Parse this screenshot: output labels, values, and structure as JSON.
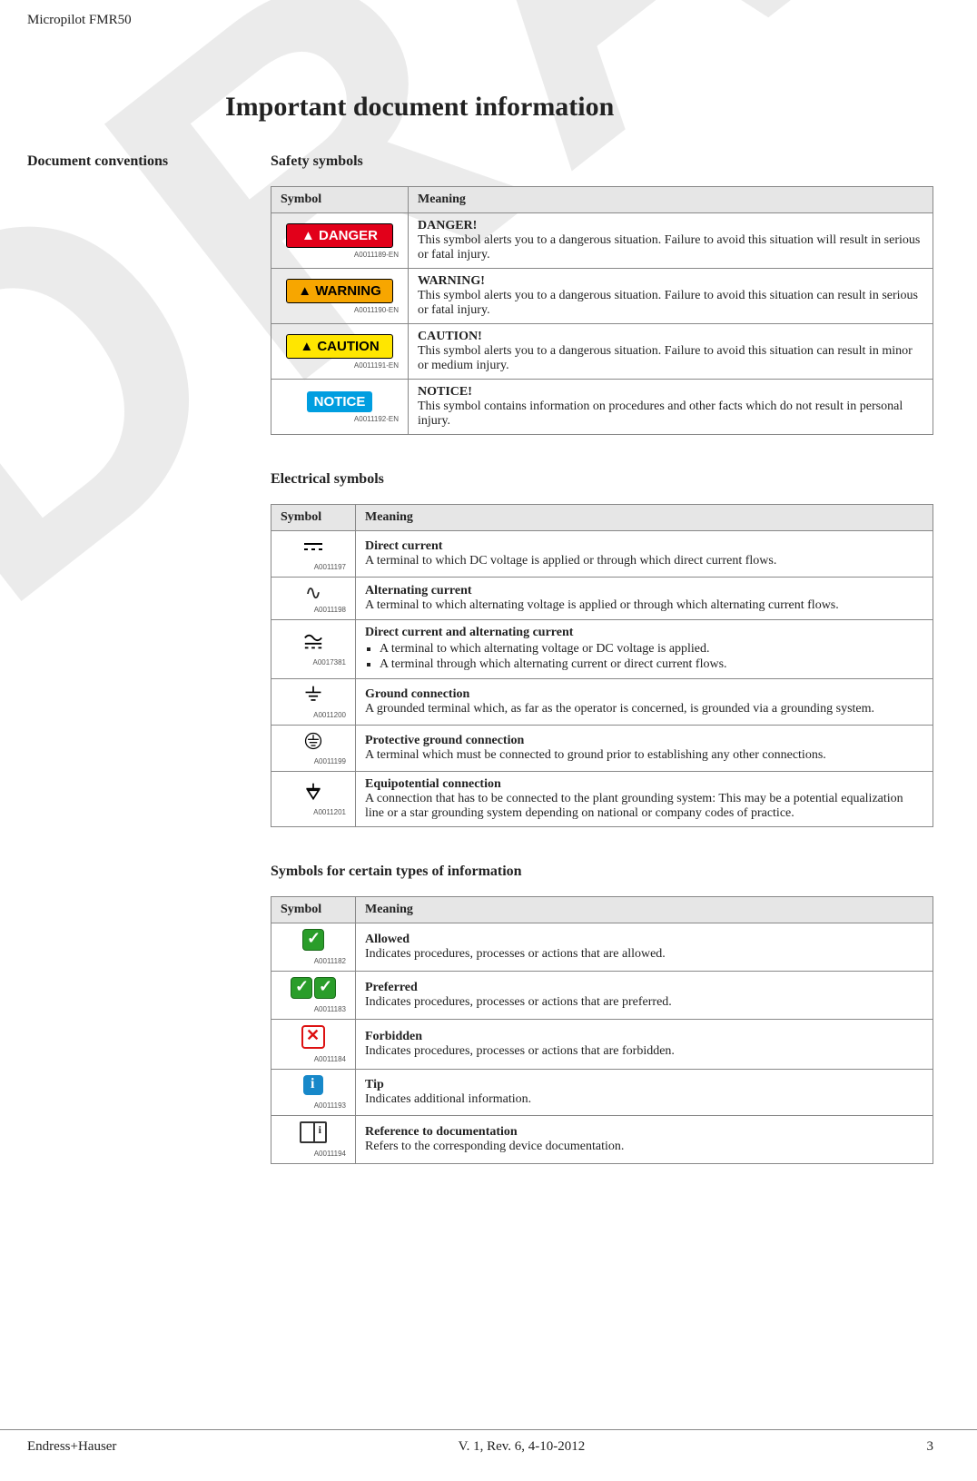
{
  "header": {
    "product": "Micropilot FMR50"
  },
  "title": "Important document information",
  "sideLabel": "Document conventions",
  "safety": {
    "heading": "Safety symbols",
    "cols": {
      "symbol": "Symbol",
      "meaning": "Meaning"
    },
    "rows": [
      {
        "badge": "DANGER",
        "badgeClass": "danger",
        "ref": "A0011189-EN",
        "title": "DANGER!",
        "desc": "This symbol alerts you to a dangerous situation. Failure to avoid this situation will result in serious or fatal injury."
      },
      {
        "badge": "WARNING",
        "badgeClass": "warning",
        "ref": "A0011190-EN",
        "title": "WARNING!",
        "desc": "This symbol alerts you to a dangerous situation. Failure to avoid this situation can result in serious or fatal injury."
      },
      {
        "badge": "CAUTION",
        "badgeClass": "caution",
        "ref": "A0011191-EN",
        "title": "CAUTION!",
        "desc": "This symbol alerts you to a dangerous situation. Failure to avoid this situation can result in minor or medium injury."
      },
      {
        "badge": "NOTICE",
        "badgeClass": "notice",
        "ref": "A0011192-EN",
        "title": "NOTICE!",
        "desc": "This symbol contains information on procedures and other facts which do not result in personal injury."
      }
    ]
  },
  "electrical": {
    "heading": "Electrical symbols",
    "cols": {
      "symbol": "Symbol",
      "meaning": "Meaning"
    },
    "rows": [
      {
        "icon": "dc",
        "ref": "A0011197",
        "title": "Direct current",
        "desc": "A terminal to which DC voltage is applied or through which direct current flows."
      },
      {
        "icon": "ac",
        "ref": "A0011198",
        "title": "Alternating current",
        "desc": "A terminal to which alternating voltage is applied or through which alternating current flows."
      },
      {
        "icon": "acdc",
        "ref": "A0017381",
        "title": "Direct current and alternating current",
        "bullets": [
          "A terminal to which alternating voltage or DC voltage is applied.",
          "A terminal through which alternating current or direct current flows."
        ]
      },
      {
        "icon": "gnd",
        "ref": "A0011200",
        "title": "Ground connection",
        "desc": "A grounded terminal which, as far as the operator is concerned, is grounded via a grounding system."
      },
      {
        "icon": "pe",
        "ref": "A0011199",
        "title": "Protective ground connection",
        "desc": "A terminal which must be connected to ground prior to establishing any other connections."
      },
      {
        "icon": "eq",
        "ref": "A0011201",
        "title": "Equipotential connection",
        "desc": "A connection that has to be connected to the plant grounding system: This may be a potential equalization line or a star grounding system depending on national or company codes of practice."
      }
    ]
  },
  "info": {
    "heading": "Symbols for certain types of information",
    "cols": {
      "symbol": "Symbol",
      "meaning": "Meaning"
    },
    "rows": [
      {
        "icon": "allowed",
        "ref": "A0011182",
        "title": "Allowed",
        "desc": "Indicates procedures, processes or actions that are allowed."
      },
      {
        "icon": "preferred",
        "ref": "A0011183",
        "title": "Preferred",
        "desc": "Indicates procedures, processes or actions that are preferred."
      },
      {
        "icon": "forbidden",
        "ref": "A0011184",
        "title": "Forbidden",
        "desc": "Indicates procedures, processes or actions that are forbidden."
      },
      {
        "icon": "tip",
        "ref": "A0011193",
        "title": "Tip",
        "desc": "Indicates additional information."
      },
      {
        "icon": "docref",
        "ref": "A0011194",
        "title": "Reference to documentation",
        "desc": "Refers to the corresponding device documentation."
      }
    ]
  },
  "footer": {
    "left": "Endress+Hauser",
    "center": "V. 1, Rev. 6, 4-10-2012",
    "right": "3"
  },
  "watermark": "DRAFT"
}
